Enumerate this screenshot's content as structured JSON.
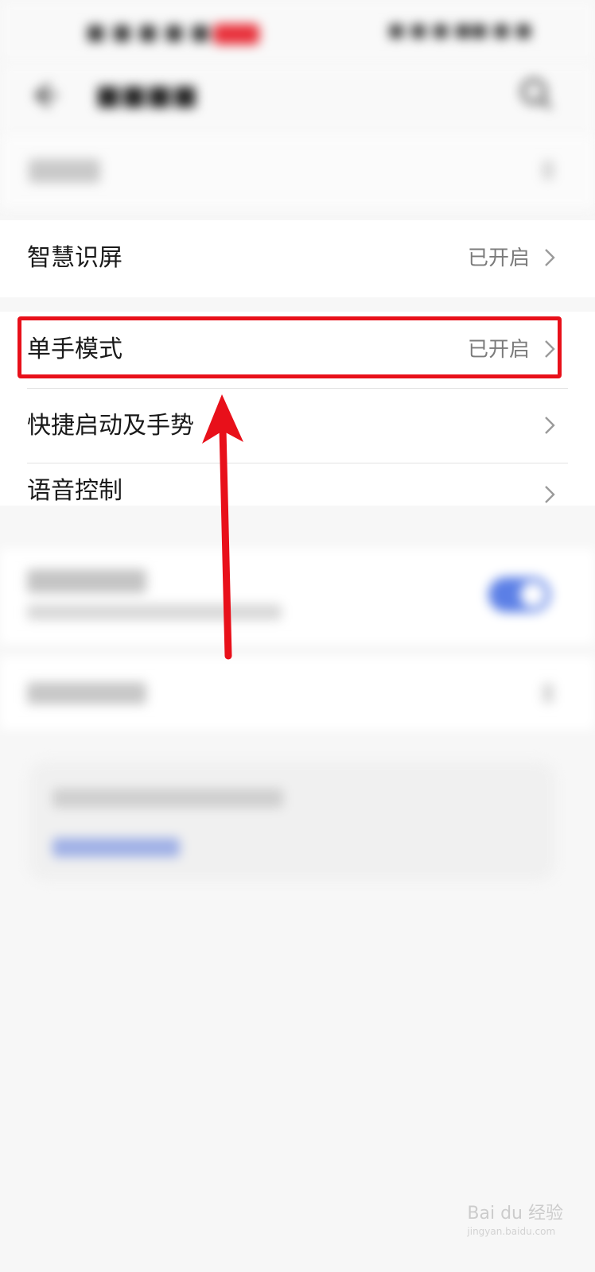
{
  "settings": {
    "items": [
      {
        "label": "智慧识屏",
        "value": "已开启"
      },
      {
        "label": "单手模式",
        "value": "已开启"
      },
      {
        "label": "快捷启动及手势",
        "value": ""
      },
      {
        "label": "语音控制",
        "value": ""
      }
    ]
  },
  "annotation": {
    "highlight_color": "#e8101a",
    "arrow_color": "#e8101a"
  },
  "colors": {
    "toggle_on": "#5b7fe6",
    "value_text": "#7b7b7b"
  },
  "icons": [
    "back-arrow-icon",
    "search-icon",
    "chevron-right-icon"
  ],
  "watermark": {
    "brand": "Bai du 经验",
    "url": "jingyan.baidu.com"
  }
}
